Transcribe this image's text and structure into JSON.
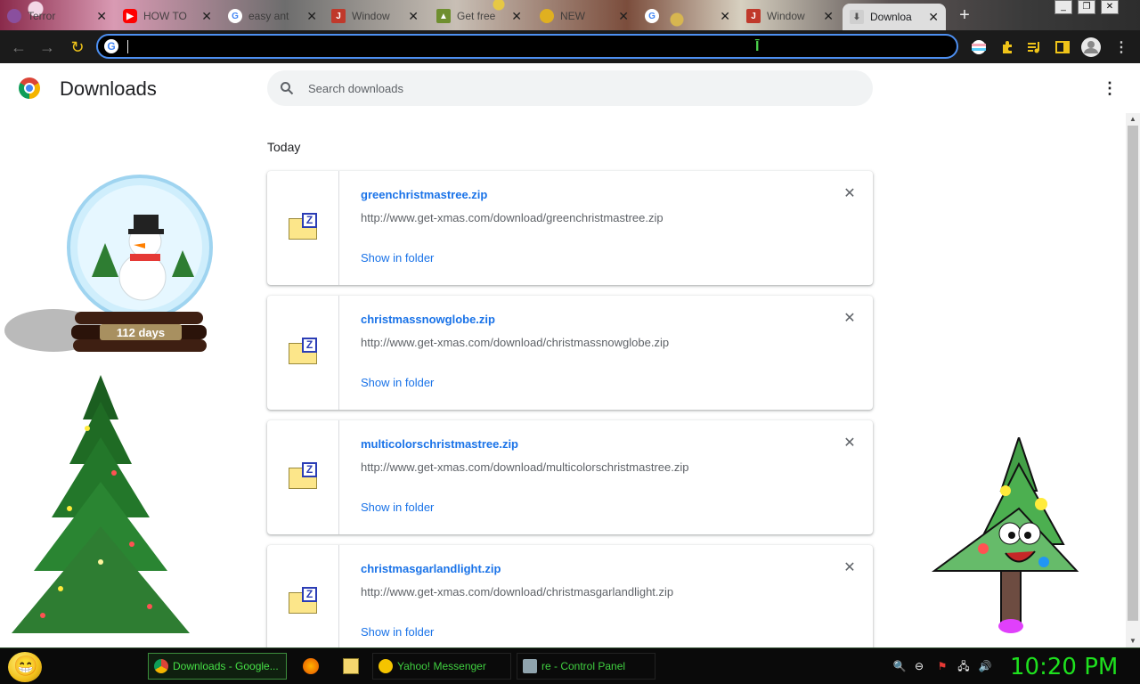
{
  "browser": {
    "tabs": [
      {
        "label": "Terror",
        "icon": "generic-page-icon",
        "color": "#8a4f9e"
      },
      {
        "label": "HOW TO",
        "icon": "youtube-icon",
        "color": "#ff0000"
      },
      {
        "label": "easy ant",
        "icon": "google-icon",
        "color": "#4285f4"
      },
      {
        "label": "Window",
        "icon": "jw-icon",
        "color": "#c0392b"
      },
      {
        "label": "Get free",
        "icon": "xmas-tree-icon",
        "color": "#6f8f2f"
      },
      {
        "label": "NEW",
        "icon": "yellow-globe-icon",
        "color": "#e0b020"
      },
      {
        "label": "",
        "icon": "google-icon",
        "color": "#4285f4"
      },
      {
        "label": "Window",
        "icon": "jw-icon",
        "color": "#c0392b"
      },
      {
        "label": "Downloa",
        "icon": "download-icon",
        "color": "#555555",
        "active": true
      }
    ],
    "new_tab": "+",
    "window_controls": [
      "_",
      "❐",
      "✕"
    ],
    "address_value": ""
  },
  "page": {
    "title": "Downloads",
    "search_placeholder": "Search downloads",
    "date_header": "Today",
    "show_in_folder": "Show in folder",
    "downloads": [
      {
        "filename": "greenchristmastree.zip",
        "url": "http://www.get-xmas.com/download/greenchristmastree.zip"
      },
      {
        "filename": "christmassnowglobe.zip",
        "url": "http://www.get-xmas.com/download/christmassnowglobe.zip"
      },
      {
        "filename": "multicolorschristmastree.zip",
        "url": "http://www.get-xmas.com/download/multicolorschristmastree.zip"
      },
      {
        "filename": "christmasgarlandlight.zip",
        "url": "http://www.get-xmas.com/download/christmasgarlandlight.zip"
      }
    ]
  },
  "decorations": {
    "countdown": "112 days"
  },
  "taskbar": {
    "tasks": [
      {
        "label": "Downloads - Google...",
        "icon": "chrome-icon",
        "active": true
      },
      {
        "label": "Yahoo! Messenger",
        "icon": "yahoo-messenger-icon",
        "active": false
      },
      {
        "label": "re - Control Panel",
        "icon": "control-panel-icon",
        "active": false
      }
    ],
    "clock": "10:20 PM",
    "colors": {
      "accent": "#1ee01e"
    }
  }
}
